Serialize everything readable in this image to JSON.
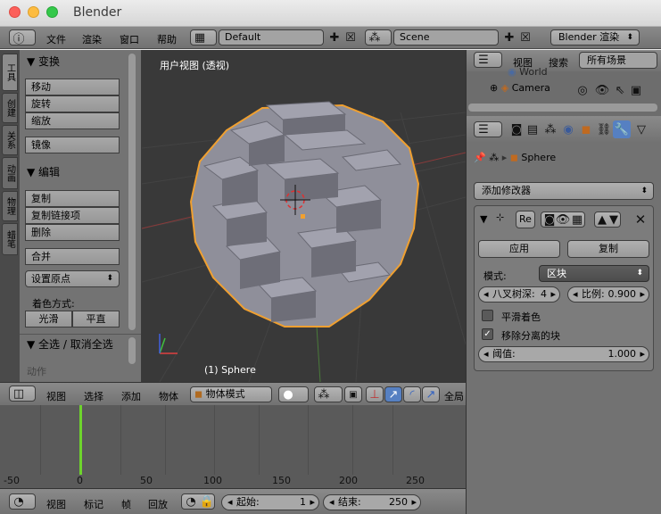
{
  "window": {
    "title": "Blender"
  },
  "info_header": {
    "menus": [
      "文件",
      "渲染",
      "窗口",
      "帮助"
    ],
    "screen_layout": "Default",
    "scene": "Scene",
    "render_engine": "Blender 渲染"
  },
  "tool_shelf": {
    "tabs": [
      "工具",
      "创建",
      "关系",
      "动画",
      "物理",
      "蜡笔"
    ],
    "transform_header": "变换",
    "transform_buttons": [
      "移动",
      "旋转",
      "缩放"
    ],
    "mirror_button": "镜像",
    "edit_header": "编辑",
    "edit_buttons": [
      "复制",
      "复制链接项",
      "删除"
    ],
    "join_button": "合并",
    "set_origin": "设置原点",
    "shading_label": "着色方式:",
    "shading_smooth": "光滑",
    "shading_flat": "平直",
    "select_toggle_header": "全选 / 取消全选",
    "operator_header": "动作"
  },
  "viewport": {
    "title": "用户视图 (透视)",
    "object_label": "(1) Sphere",
    "menus": [
      "视图",
      "选择",
      "添加",
      "物体"
    ],
    "mode": "物体模式",
    "global": "全局"
  },
  "timeline": {
    "ticks": [
      "-50",
      "0",
      "50",
      "100",
      "150",
      "200",
      "250"
    ],
    "menus": [
      "视图",
      "标记",
      "帧",
      "回放"
    ],
    "start_label": "起始:",
    "start_value": "1",
    "end_label": "结束:",
    "end_value": "250",
    "current_frame": 1
  },
  "outliner": {
    "menus": [
      "视图",
      "搜索"
    ],
    "scope": "所有场景",
    "items": [
      "World",
      "Camera"
    ]
  },
  "properties": {
    "object_name": "Sphere",
    "add_modifier": "添加修改器",
    "modifier_name": "Re",
    "apply_button": "应用",
    "copy_button": "复制",
    "mode_label": "模式:",
    "mode_value": "区块",
    "octree_label": "八叉树深:",
    "octree_value": "4",
    "scale_label": "比例:",
    "scale_value": "0.900",
    "smooth_shading": "平滑着色",
    "smooth_checked": false,
    "remove_disconnected": "移除分离的块",
    "remove_checked": true,
    "threshold_label": "阈值:",
    "threshold_value": "1.000"
  },
  "colors": {
    "selection_outline": "#f0a030",
    "frame_cursor": "#6ed42c",
    "active_tool": "#5680c2"
  }
}
